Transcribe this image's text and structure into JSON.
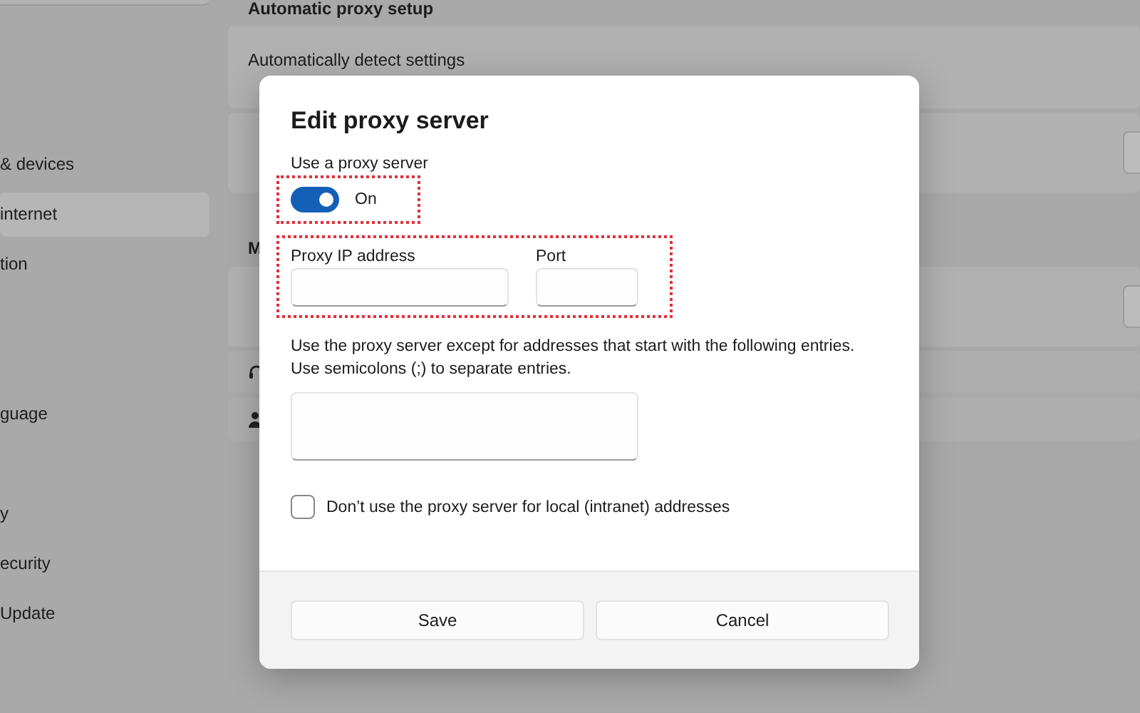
{
  "sidebar": {
    "items": [
      {
        "label": "& devices",
        "selected": false
      },
      {
        "label": "internet",
        "selected": true
      },
      {
        "label": "tion",
        "selected": false
      },
      {
        "label": "guage",
        "selected": false
      },
      {
        "label": "y",
        "selected": false
      },
      {
        "label": "ecurity",
        "selected": false
      },
      {
        "label": "Update",
        "selected": false
      }
    ]
  },
  "main": {
    "sections": [
      {
        "heading": "Automatic proxy setup",
        "cards": [
          {
            "label": "Automatically detect settings",
            "kind": "plain"
          },
          {
            "kind": "button"
          }
        ]
      },
      {
        "heading": "M",
        "cards": [
          {
            "kind": "button"
          },
          {
            "kind": "headset"
          },
          {
            "kind": "person"
          }
        ]
      }
    ]
  },
  "dialog": {
    "title": "Edit proxy server",
    "use_proxy": {
      "label": "Use a proxy server",
      "on": true,
      "state_text": "On",
      "highlighted": true
    },
    "address": {
      "highlighted": true,
      "fields": [
        {
          "label": "Proxy IP address",
          "kind": "wide"
        },
        {
          "label": "Port",
          "kind": "narrow"
        }
      ]
    },
    "exceptions": {
      "hint": "Use the proxy server except for addresses that start with the following entries.\nUse semicolons (;) to separate entries."
    },
    "local_bypass": {
      "label": "Don’t use the proxy server for local (intranet) addresses",
      "checked": false
    },
    "buttons": [
      "Save",
      "Cancel"
    ]
  }
}
